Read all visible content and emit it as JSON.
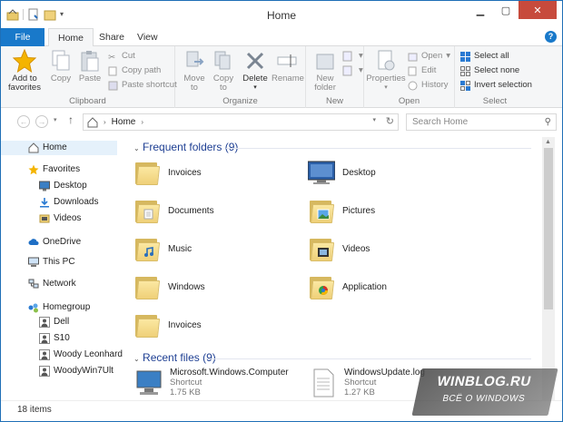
{
  "window": {
    "title": "Home"
  },
  "ribbon_tabs": [
    "File",
    "Home",
    "Share",
    "View"
  ],
  "ribbon": {
    "clipboard": {
      "label": "Clipboard",
      "add_to_favorites": "Add to\nfavorites",
      "copy": "Copy",
      "paste": "Paste",
      "cut": "Cut",
      "copy_path": "Copy path",
      "paste_shortcut": "Paste shortcut"
    },
    "organize": {
      "label": "Organize",
      "move_to": "Move\nto",
      "copy_to": "Copy\nto",
      "delete": "Delete",
      "rename": "Rename"
    },
    "new": {
      "label": "New",
      "new_folder": "New\nfolder"
    },
    "open": {
      "label": "Open",
      "properties": "Properties",
      "open": "Open",
      "edit": "Edit",
      "history": "History"
    },
    "select": {
      "label": "Select",
      "select_all": "Select all",
      "select_none": "Select none",
      "invert_selection": "Invert selection"
    }
  },
  "address": {
    "location": "Home",
    "search_placeholder": "Search Home"
  },
  "nav": [
    {
      "label": "Home",
      "icon": "home-icon",
      "indent": 0,
      "selected": true
    },
    {
      "label": "Favorites",
      "icon": "star-icon",
      "indent": 0
    },
    {
      "label": "Desktop",
      "icon": "desktop-icon",
      "indent": 1
    },
    {
      "label": "Downloads",
      "icon": "downloads-icon",
      "indent": 1
    },
    {
      "label": "Videos",
      "icon": "videos-icon",
      "indent": 1
    },
    {
      "label": "OneDrive",
      "icon": "cloud-icon",
      "indent": 0
    },
    {
      "label": "This PC",
      "icon": "computer-icon",
      "indent": 0
    },
    {
      "label": "Network",
      "icon": "network-icon",
      "indent": 0
    },
    {
      "label": "Homegroup",
      "icon": "homegroup-icon",
      "indent": 0
    },
    {
      "label": "Dell",
      "icon": "user-icon",
      "indent": 1
    },
    {
      "label": "S10",
      "icon": "user-icon",
      "indent": 1
    },
    {
      "label": "Woody Leonhard",
      "icon": "user-icon",
      "indent": 1
    },
    {
      "label": "WoodyWin7Ult",
      "icon": "user-icon",
      "indent": 1
    }
  ],
  "frequent": {
    "header": "Frequent folders (9)",
    "items": [
      {
        "label": "Invoices",
        "icon": "folder-icon"
      },
      {
        "label": "Desktop",
        "icon": "desktop-icon"
      },
      {
        "label": "Documents",
        "icon": "documents-folder-icon"
      },
      {
        "label": "Pictures",
        "icon": "pictures-folder-icon"
      },
      {
        "label": "Music",
        "icon": "music-folder-icon"
      },
      {
        "label": "Videos",
        "icon": "videos-folder-icon"
      },
      {
        "label": "Windows",
        "icon": "folder-icon"
      },
      {
        "label": "Application",
        "icon": "application-folder-icon"
      },
      {
        "label": "Invoices",
        "icon": "folder-icon"
      }
    ]
  },
  "recent": {
    "header": "Recent files (9)",
    "items": [
      {
        "name": "Microsoft.Windows.Computer",
        "type": "Shortcut",
        "size": "1.75 KB",
        "icon": "computer-shortcut-icon"
      },
      {
        "name": "WindowsUpdate.log",
        "type": "Shortcut",
        "size": "1.27 KB",
        "icon": "log-file-icon"
      }
    ]
  },
  "status": {
    "items": "18 items"
  },
  "watermark": {
    "line1": "WINBLOG.RU",
    "line2": "ВСЁ О WINDOWS"
  },
  "colors": {
    "accent": "#1979ca",
    "section_header": "#1e3f93",
    "close_button": "#c74a3c",
    "selected_nav": "#e5f1fb"
  }
}
